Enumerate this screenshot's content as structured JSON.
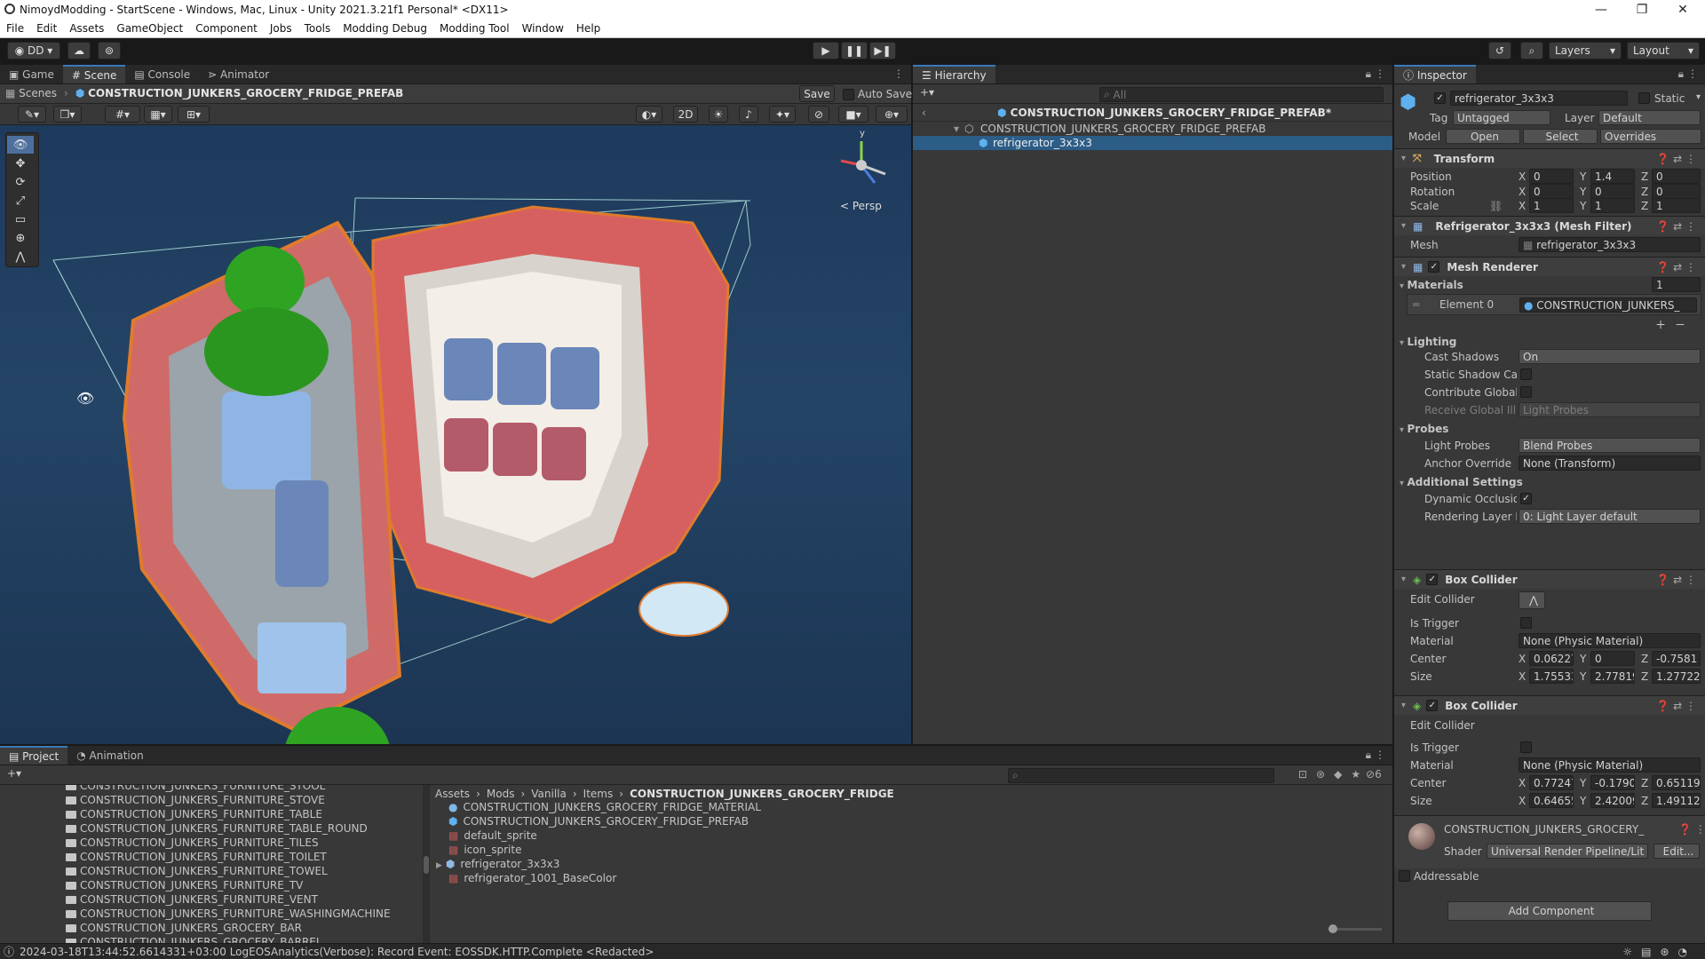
{
  "window": {
    "title": "NimoydModding - StartScene - Windows, Mac, Linux - Unity 2021.3.21f1 Personal* <DX11>",
    "min": "—",
    "max": "❐",
    "close": "✕"
  },
  "menu": [
    "File",
    "Edit",
    "Assets",
    "GameObject",
    "Component",
    "Jobs",
    "Tools",
    "Modding Debug",
    "Modding Tool",
    "Window",
    "Help"
  ],
  "toolbar": {
    "account": "DD",
    "layers": "Layers",
    "layout": "Layout"
  },
  "scene": {
    "tabs": [
      "Game",
      "Scene",
      "Console",
      "Animator"
    ],
    "breadcrumb_root": "Scenes",
    "breadcrumb_prefab": "CONSTRUCTION_JUNKERS_GROCERY_FRIDGE_PREFAB",
    "save": "Save",
    "autosave": "Auto Save",
    "mode_2d": "2D",
    "persp": "< Persp",
    "gizmo_y": "y"
  },
  "hierarchy": {
    "tab": "Hierarchy",
    "search_placeholder": "All",
    "root": "CONSTRUCTION_JUNKERS_GROCERY_FRIDGE_PREFAB*",
    "item1": "CONSTRUCTION_JUNKERS_GROCERY_FRIDGE_PREFAB",
    "item2": "refrigerator_3x3x3"
  },
  "inspector": {
    "tab": "Inspector",
    "name": "refrigerator_3x3x3",
    "static": "Static",
    "tag_label": "Tag",
    "tag": "Untagged",
    "layer_label": "Layer",
    "layer": "Default",
    "model_label": "Model",
    "open": "Open",
    "select": "Select",
    "overrides": "Overrides",
    "transform": {
      "title": "Transform",
      "position": "Position",
      "rotation": "Rotation",
      "scale": "Scale",
      "px": "0",
      "py": "1.4",
      "pz": "0",
      "rx": "0",
      "ry": "0",
      "rz": "0",
      "sx": "1",
      "sy": "1",
      "sz": "1"
    },
    "meshfilter": {
      "title": "Refrigerator_3x3x3 (Mesh Filter)",
      "mesh_label": "Mesh",
      "mesh": "refrigerator_3x3x3"
    },
    "meshrenderer": {
      "title": "Mesh Renderer",
      "materials": "Materials",
      "materials_count": "1",
      "element0": "Element 0",
      "element0_val": "CONSTRUCTION_JUNKERS_",
      "lighting": "Lighting",
      "cast_shadows": "Cast Shadows",
      "cast_shadows_val": "On",
      "static_shadow": "Static Shadow Cas",
      "contribute_gi": "Contribute Global I",
      "receive_gi": "Receive Global Illu",
      "receive_gi_val": "Light Probes",
      "probes": "Probes",
      "light_probes": "Light Probes",
      "light_probes_val": "Blend Probes",
      "anchor": "Anchor Override",
      "anchor_val": "None (Transform)",
      "additional": "Additional Settings",
      "dyn_occ": "Dynamic Occlusio",
      "rlm": "Rendering Layer M",
      "rlm_val": "0: Light Layer default"
    },
    "box1": {
      "title": "Box Collider",
      "edit": "Edit Collider",
      "trigger": "Is Trigger",
      "material": "Material",
      "material_val": "None (Physic Material)",
      "center": "Center",
      "cx": "0.06227",
      "cy": "0",
      "cz": "-0.7581",
      "size": "Size",
      "sx": "1.75533",
      "sy": "2.77819",
      "sz": "1.27722"
    },
    "box2": {
      "title": "Box Collider",
      "edit": "Edit Collider",
      "trigger": "Is Trigger",
      "material": "Material",
      "material_val": "None (Physic Material)",
      "center": "Center",
      "cx": "0.77247",
      "cy": "-0.1790",
      "cz": "0.65119",
      "size": "Size",
      "sx": "0.64655",
      "sy": "2.42009",
      "sz": "1.49112"
    },
    "material": {
      "name": "CONSTRUCTION_JUNKERS_GROCERY_",
      "shader_label": "Shader",
      "shader": "Universal Render Pipeline/Lit",
      "edit": "Edit..."
    },
    "addressable": "Addressable",
    "add_component": "Add Component"
  },
  "project": {
    "tabs": [
      "Project",
      "Animation"
    ],
    "folders": [
      "CONSTRUCTION_JUNKERS_FURNITURE_STOOL",
      "CONSTRUCTION_JUNKERS_FURNITURE_STOVE",
      "CONSTRUCTION_JUNKERS_FURNITURE_TABLE",
      "CONSTRUCTION_JUNKERS_FURNITURE_TABLE_ROUND",
      "CONSTRUCTION_JUNKERS_FURNITURE_TILES",
      "CONSTRUCTION_JUNKERS_FURNITURE_TOILET",
      "CONSTRUCTION_JUNKERS_FURNITURE_TOWEL",
      "CONSTRUCTION_JUNKERS_FURNITURE_TV",
      "CONSTRUCTION_JUNKERS_FURNITURE_VENT",
      "CONSTRUCTION_JUNKERS_FURNITURE_WASHINGMACHINE",
      "CONSTRUCTION_JUNKERS_GROCERY_BAR",
      "CONSTRUCTION_JUNKERS_GROCERY_BARREL"
    ],
    "path": [
      "Assets",
      "Mods",
      "Vanilla",
      "Items",
      "CONSTRUCTION_JUNKERS_GROCERY_FRIDGE"
    ],
    "files": [
      "CONSTRUCTION_JUNKERS_GROCERY_FRIDGE_MATERIAL",
      "CONSTRUCTION_JUNKERS_GROCERY_FRIDGE_PREFAB",
      "default_sprite",
      "icon_sprite",
      "refrigerator_3x3x3",
      "refrigerator_1001_BaseColor"
    ],
    "hidden_count": "6"
  },
  "status": "2024-03-18T13:44:52.6614331+03:00 LogEOSAnalytics(Verbose): Record Event: EOSSDK.HTTP.Complete <Redacted>"
}
